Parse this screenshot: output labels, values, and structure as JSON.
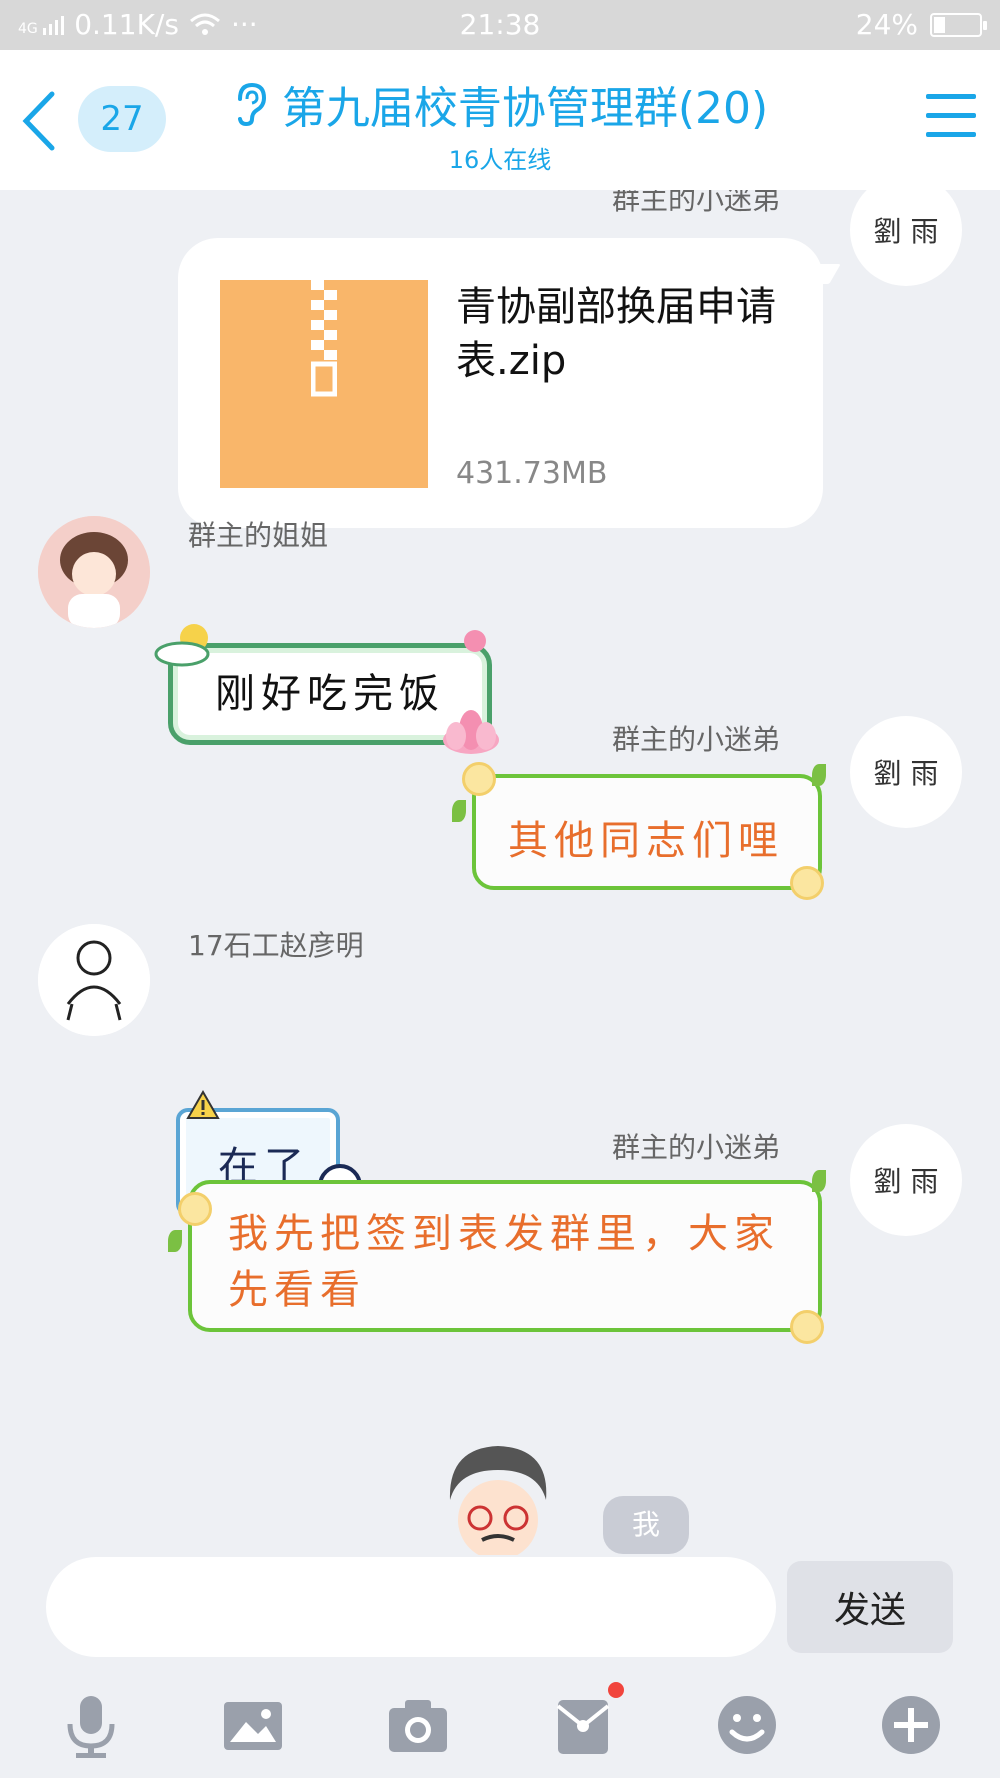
{
  "status_bar": {
    "network": "4G",
    "speed": "0.11K/s",
    "time": "21:38",
    "battery": "24%",
    "battery_level": 0.24,
    "more": "···"
  },
  "header": {
    "unread": "27",
    "title": "第九届校青协管理群(20)",
    "subtitle": "16人在线"
  },
  "colors": {
    "accent": "#1aa6e8",
    "zip": "#f9b66a",
    "sticker_text": "#e86e2c",
    "notify_dot": "#f1453d"
  },
  "messages": [
    {
      "sender": "群主的小迷弟",
      "avatar_text": "劉 雨",
      "type": "file",
      "file_name": "青协副部换届申请表.zip",
      "file_size": "431.73MB",
      "icon": "zip-icon"
    },
    {
      "sender": "群主的姐姐",
      "type": "text",
      "text": "刚好吃完饭"
    },
    {
      "sender": "群主的小迷弟",
      "avatar_text": "劉 雨",
      "type": "text",
      "text": "其他同志们哩"
    },
    {
      "sender": "17石工赵彦明",
      "type": "text",
      "text": "在了"
    },
    {
      "sender": "群主的小迷弟",
      "avatar_text": "劉 雨",
      "type": "text",
      "text": "我先把签到表发群里，大家先看看"
    }
  ],
  "me_label": "我",
  "input": {
    "value": "",
    "placeholder": ""
  },
  "send_label": "发送",
  "toolbar": [
    "microphone-icon",
    "image-icon",
    "camera-icon",
    "red-packet-icon",
    "emoji-icon",
    "plus-icon"
  ]
}
